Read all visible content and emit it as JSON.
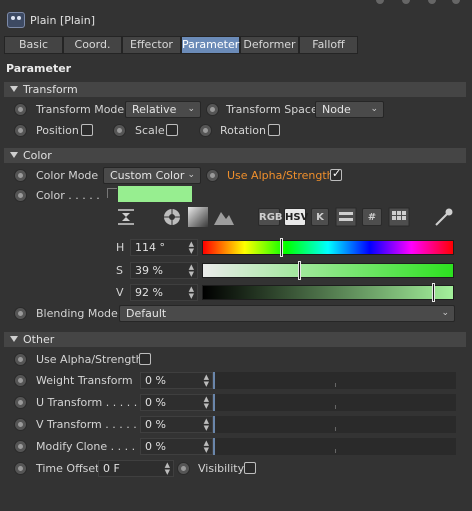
{
  "header": {
    "object_title": "Plain [Plain]"
  },
  "tabs": [
    "Basic",
    "Coord.",
    "Effector",
    "Parameter",
    "Deformer",
    "Falloff"
  ],
  "active_tab": "Parameter",
  "section_title": "Parameter",
  "transform": {
    "group_label": "Transform",
    "mode_label": "Transform Mode",
    "mode_value": "Relative",
    "space_label": "Transform Space",
    "space_value": "Node",
    "position_label": "Position",
    "scale_label": "Scale",
    "rotation_label": "Rotation",
    "position_checked": false,
    "scale_checked": false,
    "rotation_checked": false
  },
  "color": {
    "group_label": "Color",
    "mode_label": "Color Mode",
    "mode_value": "Custom Color",
    "use_alpha_label": "Use Alpha/Strength",
    "use_alpha_checked": true,
    "color_label": "Color . . . . .",
    "swatch_color": "#97ee90",
    "picker_buttons": [
      "RGB",
      "HSV",
      "K"
    ],
    "active_picker": "HSV",
    "icons": [
      "collapse-icon",
      "color-wheel-icon",
      "spectrum-icon",
      "image-icon",
      "mixer-icon",
      "hex-icon",
      "swatches-icon",
      "eyedropper-icon"
    ],
    "hex_symbol": "#",
    "h_label": "H",
    "h_value": "114 °",
    "h_level": 0.317,
    "s_label": "S",
    "s_value": "39 %",
    "s_level": 0.39,
    "v_label": "V",
    "v_value": "92 %",
    "v_level": 0.92,
    "blending_label": "Blending Mode",
    "blending_value": "Default"
  },
  "other": {
    "group_label": "Other",
    "use_alpha_label": "Use Alpha/Strength",
    "use_alpha_checked": false,
    "weight_label": "Weight Transform",
    "weight_value": "0 %",
    "u_label": "U Transform . . . . .",
    "u_value": "0 %",
    "v_label": "V Transform . . . . .",
    "v_value": "0 %",
    "clone_label": "Modify Clone . . . .",
    "clone_value": "0 %",
    "time_label": "Time Offset",
    "time_value": "0 F",
    "visibility_label": "Visibility",
    "visibility_checked": false
  },
  "colors": {
    "accent": "#6b8bb8",
    "orange_label": "#ef8f2c",
    "background": "#333333"
  }
}
